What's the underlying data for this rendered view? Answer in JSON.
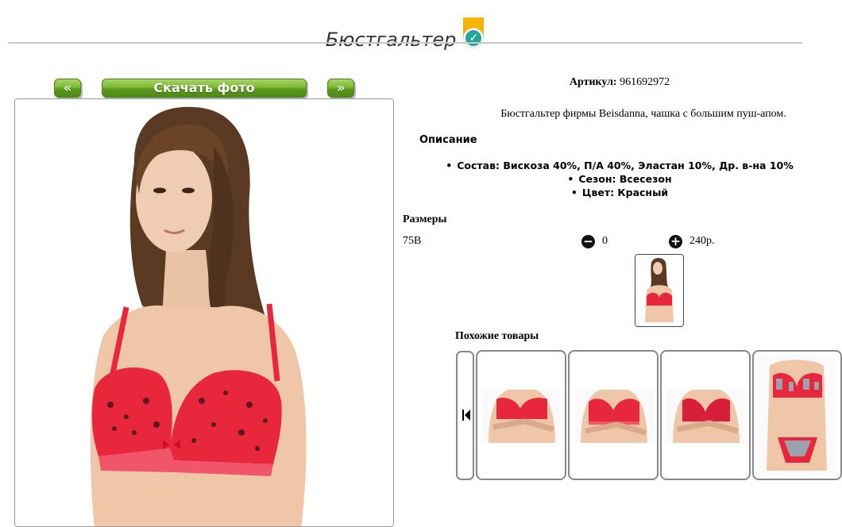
{
  "product": {
    "title": "Бюстгальтер",
    "article_label": "Артикул:",
    "article_value": "961692972",
    "description": "Бюстгальтер фирмы Beisdanna, чашка с большим пуш-апом.",
    "description_heading": "Описание",
    "properties": [
      "Состав: Вискоза 40%, П/А 40%, Эластан 10%, Др. в-на 10%",
      "Сезон: Всесезон",
      "Цвет: Красный"
    ]
  },
  "gallery": {
    "prev_label": "«",
    "download_label": "Скачать фото",
    "next_label": "»"
  },
  "sizes": {
    "heading": "Размеры",
    "items": [
      {
        "name": "75B",
        "minus_icon": "minus-circle-icon",
        "qty": "0",
        "plus_icon": "plus-circle-icon",
        "price": "240р."
      }
    ]
  },
  "similar": {
    "heading": "Похожие товары",
    "prev_icon": "skip-back-icon"
  },
  "colors": {
    "accent_green": "#6aa82a",
    "badge_yellow": "#f4b400",
    "badge_teal": "#26a69a",
    "product_red": "#e8263c"
  }
}
